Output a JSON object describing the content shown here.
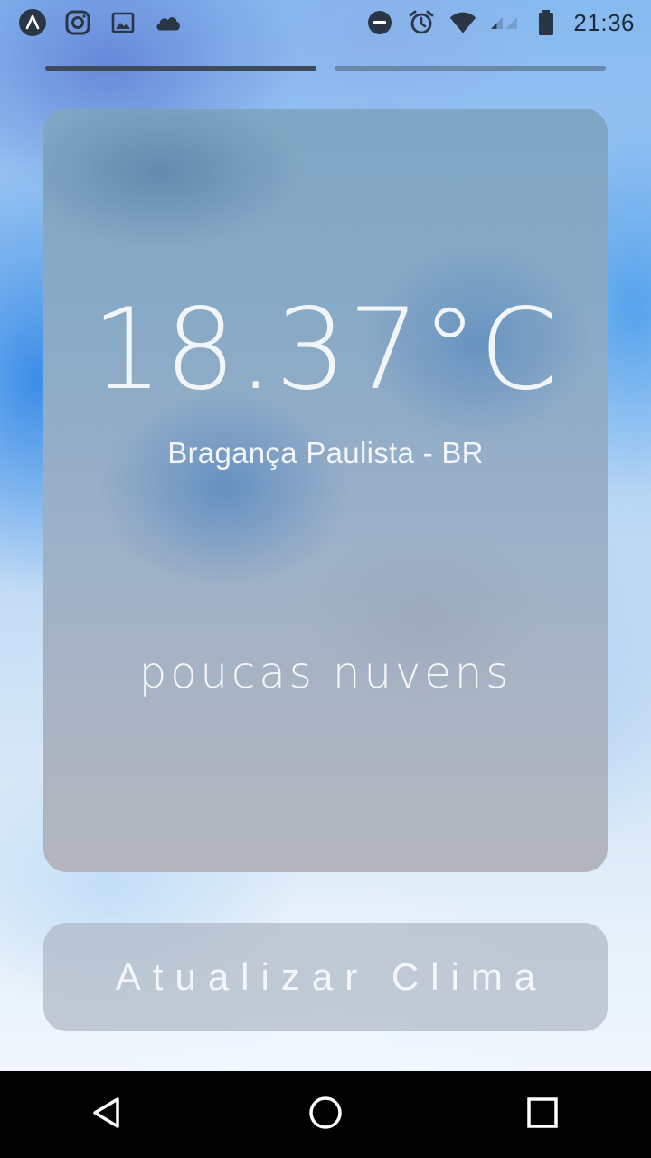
{
  "status_bar": {
    "time": "21:36",
    "left_icons": [
      "app-logo-icon",
      "instagram-icon",
      "gallery-icon",
      "cloud-icon"
    ],
    "right_icons": [
      "do-not-disturb-icon",
      "alarm-icon",
      "wifi-icon",
      "cell-signal-icon",
      "battery-icon"
    ]
  },
  "pager": {
    "pages": 2,
    "active_index": 0
  },
  "weather": {
    "temperature": "18.37°C",
    "location": "Bragança Paulista - BR",
    "description": "poucas nuvens"
  },
  "actions": {
    "update_label": "Atualizar Clima"
  },
  "nav_bar": {
    "buttons": [
      "back-icon",
      "home-icon",
      "recents-icon"
    ]
  }
}
